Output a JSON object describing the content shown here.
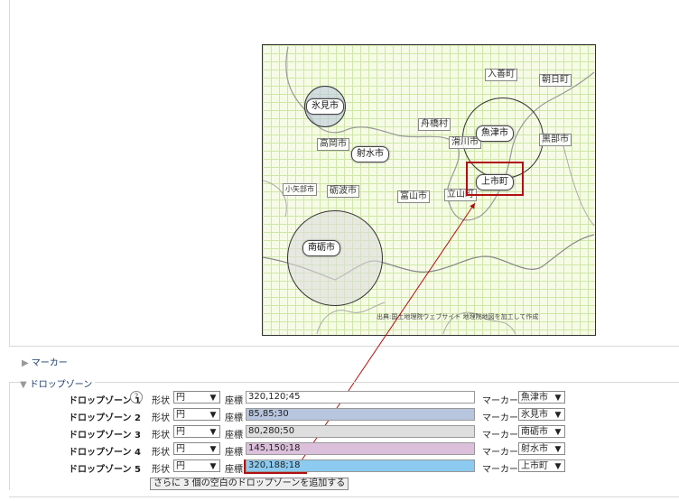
{
  "map": {
    "credit": "出典:国土地理院ウェブサイト 地理院地図を加工して作成",
    "cities": [
      "入善町",
      "朝日町",
      "舟橋村",
      "黒部市",
      "滑川市",
      "高岡市",
      "小矢部市",
      "砺波市",
      "富山市",
      "立山町"
    ],
    "markers": [
      "氷見市",
      "射水市",
      "魚津市",
      "上市町",
      "南砺市"
    ]
  },
  "sections": {
    "markers_label": "マーカー",
    "dropzones_label": "ドロップゾーン"
  },
  "form": {
    "shape_label": "形状",
    "coord_label": "座標",
    "marker_label": "マーカー",
    "help_symbol": "?",
    "rows": [
      {
        "label": "ドロップゾーン 1",
        "shape": "円",
        "coords": "320,120;45",
        "marker": "魚津市",
        "color": "#ffffff"
      },
      {
        "label": "ドロップゾーン 2",
        "shape": "円",
        "coords": "85,85;30",
        "marker": "氷見市",
        "color": "#b7c5de"
      },
      {
        "label": "ドロップゾーン 3",
        "shape": "円",
        "coords": "80,280;50",
        "marker": "南砺市",
        "color": "#dedede"
      },
      {
        "label": "ドロップゾーン 4",
        "shape": "円",
        "coords": "145,150;18",
        "marker": "射水市",
        "color": "#dcc0db"
      },
      {
        "label": "ドロップゾーン 5",
        "shape": "円",
        "coords": "320,188;18",
        "marker": "上市町",
        "color": "#8ccaef"
      }
    ],
    "add_button": "さらに 3 個の空白のドロップゾーンを追加する"
  },
  "icons": {
    "collapsed": "triangle-right-icon",
    "expanded": "triangle-down-icon",
    "dropdown": "chevron-down-icon"
  }
}
